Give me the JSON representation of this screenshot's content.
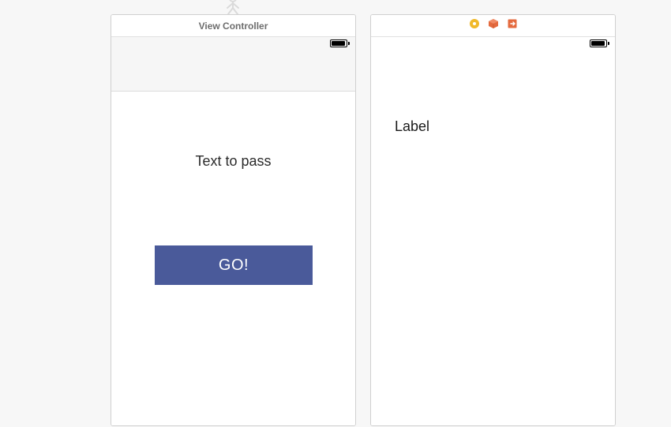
{
  "left_scene": {
    "title": "View Controller",
    "textfield_placeholder": "Text to pass",
    "button_label": "GO!",
    "button_bg": "#4a5a9a"
  },
  "right_scene": {
    "label_text": "Label"
  },
  "icon_colors": {
    "segue_circle": "#f0b92a",
    "segue_cube": "#e46a3e",
    "segue_exit": "#e46a3e"
  }
}
